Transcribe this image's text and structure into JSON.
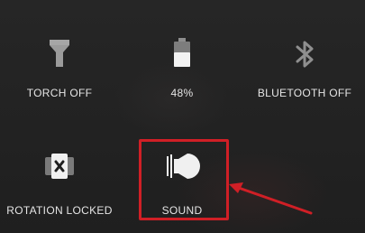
{
  "quick_settings": {
    "tiles": [
      {
        "id": "torch",
        "label": "TORCH OFF",
        "icon": "flashlight-icon"
      },
      {
        "id": "battery",
        "label": "48%",
        "icon": "battery-icon",
        "level_percent": 48
      },
      {
        "id": "bluetooth",
        "label": "BLUETOOTH OFF",
        "icon": "bluetooth-icon"
      },
      {
        "id": "rotation",
        "label": "ROTATION LOCKED",
        "icon": "rotation-lock-icon"
      },
      {
        "id": "sound",
        "label": "SOUND",
        "icon": "volume-icon"
      }
    ]
  },
  "annotation": {
    "highlight_color": "#d01f26",
    "arrow_color": "#d01f26"
  }
}
